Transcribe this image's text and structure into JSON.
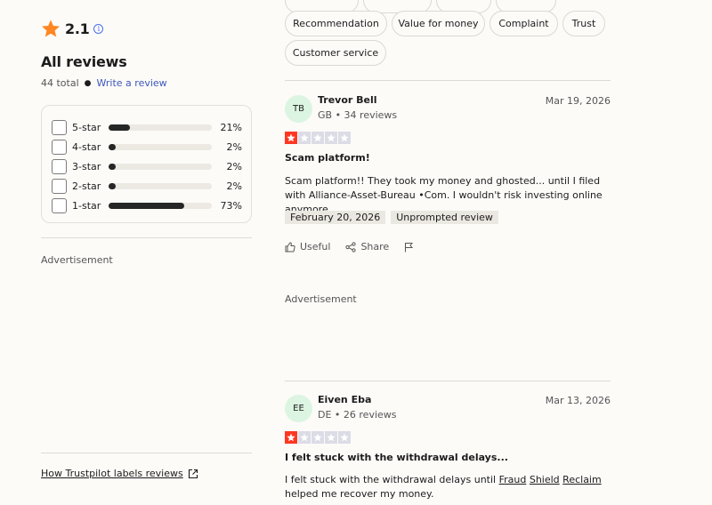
{
  "summary": {
    "rating": "2.1",
    "heading": "All reviews",
    "total": "44 total",
    "write_link": "Write a review",
    "distribution": [
      {
        "label": "5-star",
        "pct": "21%",
        "fill": 0.21
      },
      {
        "label": "4-star",
        "pct": "2%",
        "fill": 0.02
      },
      {
        "label": "3-star",
        "pct": "2%",
        "fill": 0.02
      },
      {
        "label": "2-star",
        "pct": "2%",
        "fill": 0.02
      },
      {
        "label": "1-star",
        "pct": "73%",
        "fill": 0.73
      }
    ],
    "advertisement": "Advertisement",
    "labels_link": "How Trustpilot labels reviews"
  },
  "filters": {
    "chips": [
      "Recommendation",
      "Value for money",
      "Complaint",
      "Trust",
      "Customer service"
    ]
  },
  "reviews": [
    {
      "initials": "TB",
      "name": "Trevor Bell",
      "meta": "GB • 34 reviews",
      "date": "Mar 19, 2026",
      "stars": 1,
      "title": "Scam platform!",
      "body": "Scam platform!! They took my money and ghosted... until I filed with Alliance-Asset-Bureau •Com. I wouldn't risk investing online anymore.",
      "tags": [
        "February 20, 2026",
        "Unprompted review"
      ],
      "useful": "Useful",
      "share": "Share"
    },
    {
      "initials": "EE",
      "name": "Eiven Eba",
      "meta": "DE • 26 reviews",
      "date": "Mar 13, 2026",
      "stars": 1,
      "title": "I felt stuck with the withdrawal delays...",
      "body_pre": "I felt stuck with the withdrawal delays until ",
      "body_link1": "Fraud",
      "body_link2": "Shield",
      "body_link3": "Reclaim",
      "body_post": " helped me recover my money."
    }
  ],
  "advertisement_mid": "Advertisement",
  "colors": {
    "star_orange": "#ff8622",
    "one_star_red": "#ff3722",
    "avatar_green": "#dcf5e2",
    "link_blue": "#3c57bc"
  }
}
